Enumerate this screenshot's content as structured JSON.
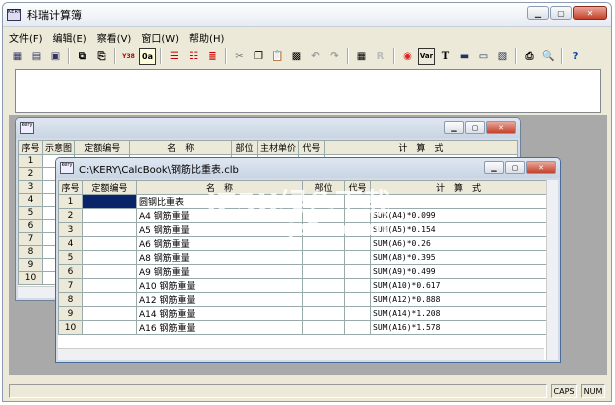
{
  "app": {
    "title": "科瑞计算簿",
    "icon_text": "KERY"
  },
  "menu": [
    "文件(F)",
    "编辑(E)",
    "察看(V)",
    "窗口(W)",
    "帮助(H)"
  ],
  "toolbar": {
    "var_label": "Var",
    "t_label": "T",
    "r_label": "R",
    "help_label": "?",
    "y38_label": "Y38",
    "a_label": "0a"
  },
  "bg_window": {
    "icon_text": "kery",
    "headers": [
      "序号",
      "示意图",
      "定额编号",
      "名　称",
      "部位",
      "主材单价",
      "代号",
      "计　算　式"
    ],
    "rows": [
      "1",
      "2",
      "3",
      "4",
      "5",
      "6",
      "7",
      "8",
      "9",
      "10"
    ]
  },
  "fg_window": {
    "icon_text": "kery",
    "title": "C:\\KERY\\CalcBook\\钢筋比重表.clb",
    "headers": [
      "序号",
      "定额编号",
      "名　称",
      "部位",
      "代号",
      "计　算　式"
    ],
    "rows": [
      {
        "n": "1",
        "name": "圆钢比重表",
        "formula": ""
      },
      {
        "n": "2",
        "name": "A4 钢筋重量",
        "formula": "SUM(A4)*0.099"
      },
      {
        "n": "3",
        "name": "A5 钢筋重量",
        "formula": "SUM(A5)*0.154"
      },
      {
        "n": "4",
        "name": "A6 钢筋重量",
        "formula": "SUM(A6)*0.26"
      },
      {
        "n": "5",
        "name": "A8 钢筋重量",
        "formula": "SUM(A8)*0.395"
      },
      {
        "n": "6",
        "name": "A9 钢筋重量",
        "formula": "SUM(A9)*0.499"
      },
      {
        "n": "7",
        "name": "A10 钢筋重量",
        "formula": "SUM(A10)*0.617"
      },
      {
        "n": "8",
        "name": "A12 钢筋重量",
        "formula": "SUM(A12)*0.888"
      },
      {
        "n": "9",
        "name": "A14 钢筋重量",
        "formula": "SUM(A14)*1.208"
      },
      {
        "n": "10",
        "name": "A16 钢筋重量",
        "formula": "SUM(A16)*1.578"
      }
    ]
  },
  "status": {
    "caps": "CAPS",
    "num": "NUM"
  },
  "watermark": {
    "main": "JZ5U绿色下载",
    "url": "www.jz5u.com"
  }
}
